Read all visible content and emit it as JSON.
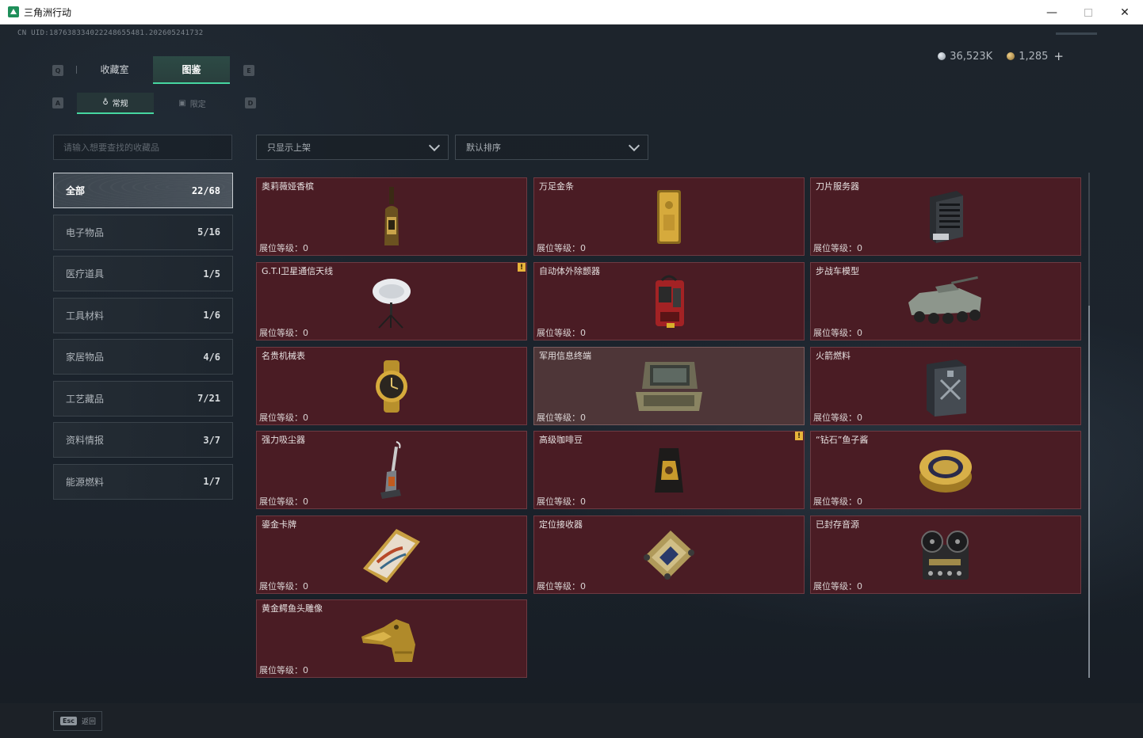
{
  "window": {
    "title": "三角洲行动",
    "minimize": "—",
    "close": "✕"
  },
  "uid": "CN UID:187638334022248655481.202605241732",
  "currency": {
    "silver": "36,523K",
    "gold": "1,285",
    "add": "+"
  },
  "keys": {
    "prev_tab": "Q",
    "next_tab": "E",
    "prev_sub": "A",
    "next_sub": "D"
  },
  "tabs": [
    {
      "label": "收藏室"
    },
    {
      "label": "图鉴"
    }
  ],
  "subtabs": [
    {
      "label": "常规"
    },
    {
      "label": "限定"
    }
  ],
  "search": {
    "placeholder": "请输入想要查找的收藏品"
  },
  "filters": {
    "display": "只显示上架",
    "sort": "默认排序"
  },
  "categories": [
    {
      "label": "全部",
      "count": "22/68"
    },
    {
      "label": "电子物品",
      "count": "5/16"
    },
    {
      "label": "医疗道具",
      "count": "1/5"
    },
    {
      "label": "工具材料",
      "count": "1/6"
    },
    {
      "label": "家居物品",
      "count": "4/6"
    },
    {
      "label": "工艺藏品",
      "count": "7/21"
    },
    {
      "label": "资料情报",
      "count": "3/7"
    },
    {
      "label": "能源燃料",
      "count": "1/7"
    }
  ],
  "level_label": "展位等级：",
  "items": [
    {
      "name": "奥莉薇娅香槟",
      "level": "0",
      "icon": "champagne-bottle-icon"
    },
    {
      "name": "万足金条",
      "level": "0",
      "icon": "gold-bar-icon"
    },
    {
      "name": "刀片服务器",
      "level": "0",
      "icon": "blade-server-icon"
    },
    {
      "name": "G.T.I卫星通信天线",
      "level": "0",
      "icon": "satellite-dish-icon",
      "badge": "!"
    },
    {
      "name": "自动体外除颤器",
      "level": "0",
      "icon": "defibrillator-icon"
    },
    {
      "name": "步战车模型",
      "level": "0",
      "icon": "ifv-model-icon"
    },
    {
      "name": "名贵机械表",
      "level": "0",
      "icon": "luxury-watch-icon"
    },
    {
      "name": "军用信息终端",
      "level": "0",
      "icon": "military-terminal-icon"
    },
    {
      "name": "火箭燃料",
      "level": "0",
      "icon": "rocket-fuel-can-icon"
    },
    {
      "name": "强力吸尘器",
      "level": "0",
      "icon": "vacuum-cleaner-icon"
    },
    {
      "name": "高级咖啡豆",
      "level": "0",
      "icon": "coffee-bag-icon",
      "badge": "!"
    },
    {
      "name": "“钻石”鱼子酱",
      "level": "0",
      "icon": "caviar-tin-icon"
    },
    {
      "name": "鎏金卡牌",
      "level": "0",
      "icon": "gilded-card-icon"
    },
    {
      "name": "定位接收器",
      "level": "0",
      "icon": "gps-receiver-icon"
    },
    {
      "name": "已封存音源",
      "level": "0",
      "icon": "reel-tape-recorder-icon"
    },
    {
      "name": "黄金鳄鱼头雕像",
      "level": "0",
      "icon": "gold-crocodile-head-icon"
    }
  ],
  "footer": {
    "esc_key": "Esc",
    "back_label": "返回"
  },
  "colors": {
    "accent": "#46d6a0",
    "card_bg": "#4a1c24",
    "card_highlight": "#4e3638",
    "badge": "#e7b43a"
  }
}
